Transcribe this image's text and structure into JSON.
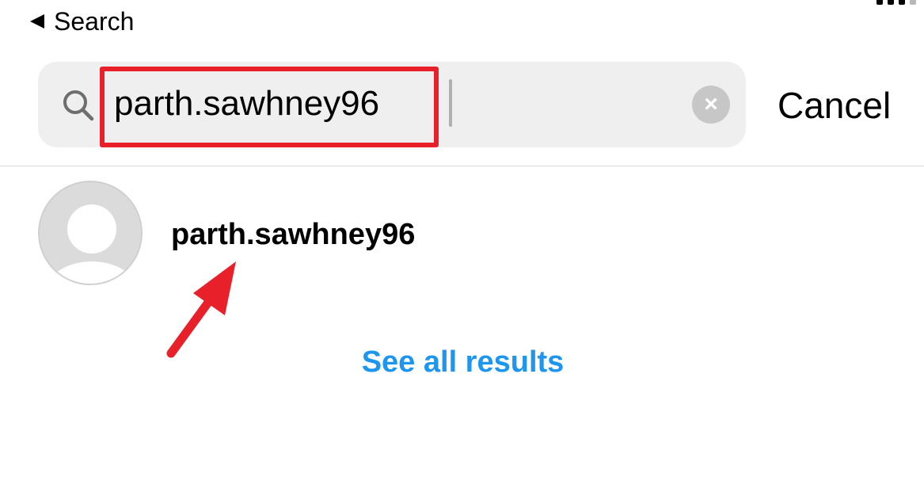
{
  "status_bar": {
    "back_label": "Search"
  },
  "search": {
    "value": "parth.sawhney96",
    "cancel_label": "Cancel",
    "clear_icon": "×"
  },
  "results": [
    {
      "username": "parth.sawhney96",
      "avatar": "default-avatar-icon"
    }
  ],
  "see_all_label": "See all results",
  "colors": {
    "accent_link": "#1d96f0",
    "annotation": "#e8202a",
    "field_bg": "#efefef",
    "divider": "#dbdbdb"
  }
}
